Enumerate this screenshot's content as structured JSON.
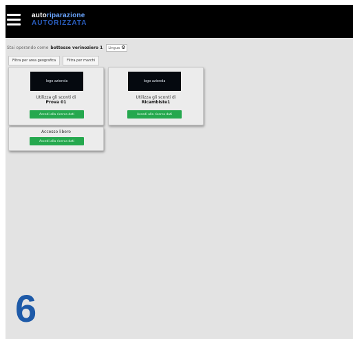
{
  "header": {
    "logo_line1_a": "auto",
    "logo_line1_b": "riparazione",
    "logo_line2": "AUTORIZZATA"
  },
  "greeting": {
    "prefix": "Stai operando come",
    "user": "bottesse verinoziero 1",
    "lang_label": "Lingua"
  },
  "filters": [
    {
      "label": "Filtra per area geografica"
    },
    {
      "label": "Filtra per marchi"
    }
  ],
  "cards": [
    {
      "logo_label": "logo azienda",
      "use_text": "Utilizza gli sconti di",
      "company": "Prova 01",
      "button_label": "Accedi alla ricerca dati"
    },
    {
      "logo_label": "logo azienda",
      "use_text": "Utilizza gli sconti di",
      "company": "Ricambiste1",
      "button_label": "Accedi alla ricerca dati"
    },
    {
      "title": "Accesso libero",
      "button_label": "Accedi alla ricerca dati"
    }
  ],
  "step_number": "6",
  "colors": {
    "topbar": "#000000",
    "background": "#e3e3e3",
    "accent_green": "#25a84e",
    "step_blue": "#1e5aa8"
  }
}
